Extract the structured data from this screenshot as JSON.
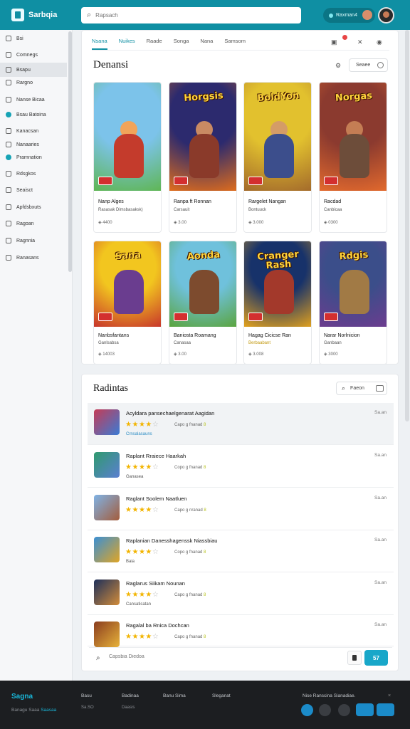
{
  "header": {
    "brand": "Sarbqia",
    "search_placeholder": "Rapsach",
    "account_label": "Raxman4"
  },
  "sidebar": {
    "items": [
      {
        "label": "Bsi"
      },
      {
        "label": "Comnegs"
      },
      {
        "label": "Bsapu"
      },
      {
        "label": "Rargno"
      },
      {
        "label": "Nanse Bicaa"
      },
      {
        "label": "Bsau Batoina"
      },
      {
        "label": "Kanacsan"
      },
      {
        "label": "Nanaaries"
      },
      {
        "label": "Pramnation"
      },
      {
        "label": "Rdsgkos"
      },
      {
        "label": "Seaisct"
      },
      {
        "label": "Apfdsbxuts"
      },
      {
        "label": "Ragoan"
      },
      {
        "label": "Ragnnia"
      },
      {
        "label": "Ranasans"
      }
    ]
  },
  "main": {
    "tabs": [
      "Nsana",
      "Nuikes",
      "Raade",
      "Songa",
      "Nana",
      "Samsom"
    ],
    "title": "Denansi",
    "sort_label": "Seaee",
    "games": [
      {
        "art_text": "",
        "title": "Nanp Alges",
        "subtitle": "Rasasak Dimsbasaksk)",
        "meta": "4400",
        "palette": [
          "#7cc3ea",
          "#5fb653",
          "#c43b2c",
          "#f1a45a"
        ]
      },
      {
        "art_text": "Horgsis",
        "title": "Ranpa ft Ronnan",
        "subtitle": "Carsauit",
        "meta": "3.00",
        "palette": [
          "#2c2a6e",
          "#e06d1c",
          "#8a3a2a",
          "#c98a63"
        ]
      },
      {
        "art_text": "BoldYon",
        "title": "Rargelet Nangan",
        "subtitle": "Bontuuck",
        "meta": "3.000",
        "palette": [
          "#e2c12e",
          "#a36a2b",
          "#3c4e8c",
          "#d49c67"
        ]
      },
      {
        "art_text": "Norgas",
        "title": "Racdad",
        "subtitle": "Canbicaa",
        "meta": "0300",
        "palette": [
          "#8b3a2f",
          "#e36a2d",
          "#6d4d3a",
          "#c47d54"
        ]
      },
      {
        "art_text": "Sana",
        "title": "Nanbsfantans",
        "subtitle": "Ganlsabsa",
        "meta": "14003",
        "palette": [
          "#f2c61f",
          "#c7342b",
          "#6a3d8f",
          "#d58a5b"
        ]
      },
      {
        "art_text": "Aonda",
        "title": "Baniosta Roamang",
        "subtitle": "Canasaa",
        "meta": "3.00",
        "palette": [
          "#6fc1dc",
          "#5aa43c",
          "#7d4b2e",
          "#d9a06d"
        ]
      },
      {
        "art_text": "Cranger Rash",
        "title": "Hagag Cicicse Ran",
        "subtitle": "Berbaabant",
        "meta": "3.008",
        "palette": [
          "#17326a",
          "#e3a21d",
          "#a3392b",
          "#c48a5e"
        ]
      },
      {
        "art_text": "Rdgis",
        "title": "Narar Norlnicion",
        "subtitle": "Ganbaan",
        "meta": "3000",
        "palette": [
          "#3b4e8a",
          "#6d3c8f",
          "#a17a45",
          "#c99264"
        ]
      }
    ]
  },
  "list_panel": {
    "title": "Radintas",
    "filter_label": "Faeon",
    "composer_placeholder": "Capsbia Diedoa",
    "send_label": "57",
    "items": [
      {
        "title": "Acyldara pansechaelgenarat Aagidan",
        "stars": 4.5,
        "rating_text": "Capo g fnanad",
        "rating_value": "8",
        "tag": "Crnsalasauns",
        "date": "Sa.an",
        "palette": [
          "#c53b56",
          "#3a7bd5"
        ]
      },
      {
        "title": "Raplant Rraiece Haarkah",
        "stars": 4.5,
        "rating_text": "Copo g fnanad",
        "rating_value": "8",
        "tag": "Ganasea",
        "date": "Sa.an",
        "palette": [
          "#2f9a6e",
          "#5b7fd1"
        ]
      },
      {
        "title": "Raglant Soolem Naatluen",
        "stars": 4.5,
        "rating_text": "Capo g nranad",
        "rating_value": "8",
        "tag": "",
        "date": "Sa.an",
        "palette": [
          "#7fb3e6",
          "#a35c3c"
        ]
      },
      {
        "title": "Raplanian Danesshagenssk Niassbiau",
        "stars": 4.5,
        "rating_text": "Copo g fnanad",
        "rating_value": "8",
        "tag": "Baia",
        "date": "Sa.an",
        "palette": [
          "#3a8fd4",
          "#e0a525"
        ]
      },
      {
        "title": "Raglarus Siikam Nounan",
        "stars": 4.5,
        "rating_text": "Capo g fnanad",
        "rating_value": "8",
        "tag": "Cansaticatan",
        "date": "Sa.an",
        "palette": [
          "#1d2f5a",
          "#d28c3a"
        ]
      },
      {
        "title": "Ragalal ba Rnica Dochcan",
        "stars": 4.5,
        "rating_text": "Capo g fnanad",
        "rating_value": "8",
        "tag": "",
        "date": "Sa.an",
        "palette": [
          "#8a3d1f",
          "#e7b23a"
        ]
      }
    ]
  },
  "footer": {
    "brand": "Sagna",
    "copyright": "Banagu Saaa",
    "copyright_link": "Saasaa",
    "columns": [
      {
        "label": "Basu",
        "sub": "Sa.SO"
      },
      {
        "label": "Badinaa",
        "sub": "Daasis"
      },
      {
        "label": "Banu Sima",
        "sub": ""
      },
      {
        "label": "Sleganat",
        "sub": ""
      }
    ],
    "note": "Nise Ranscina Sianadiae.",
    "close": "×"
  }
}
